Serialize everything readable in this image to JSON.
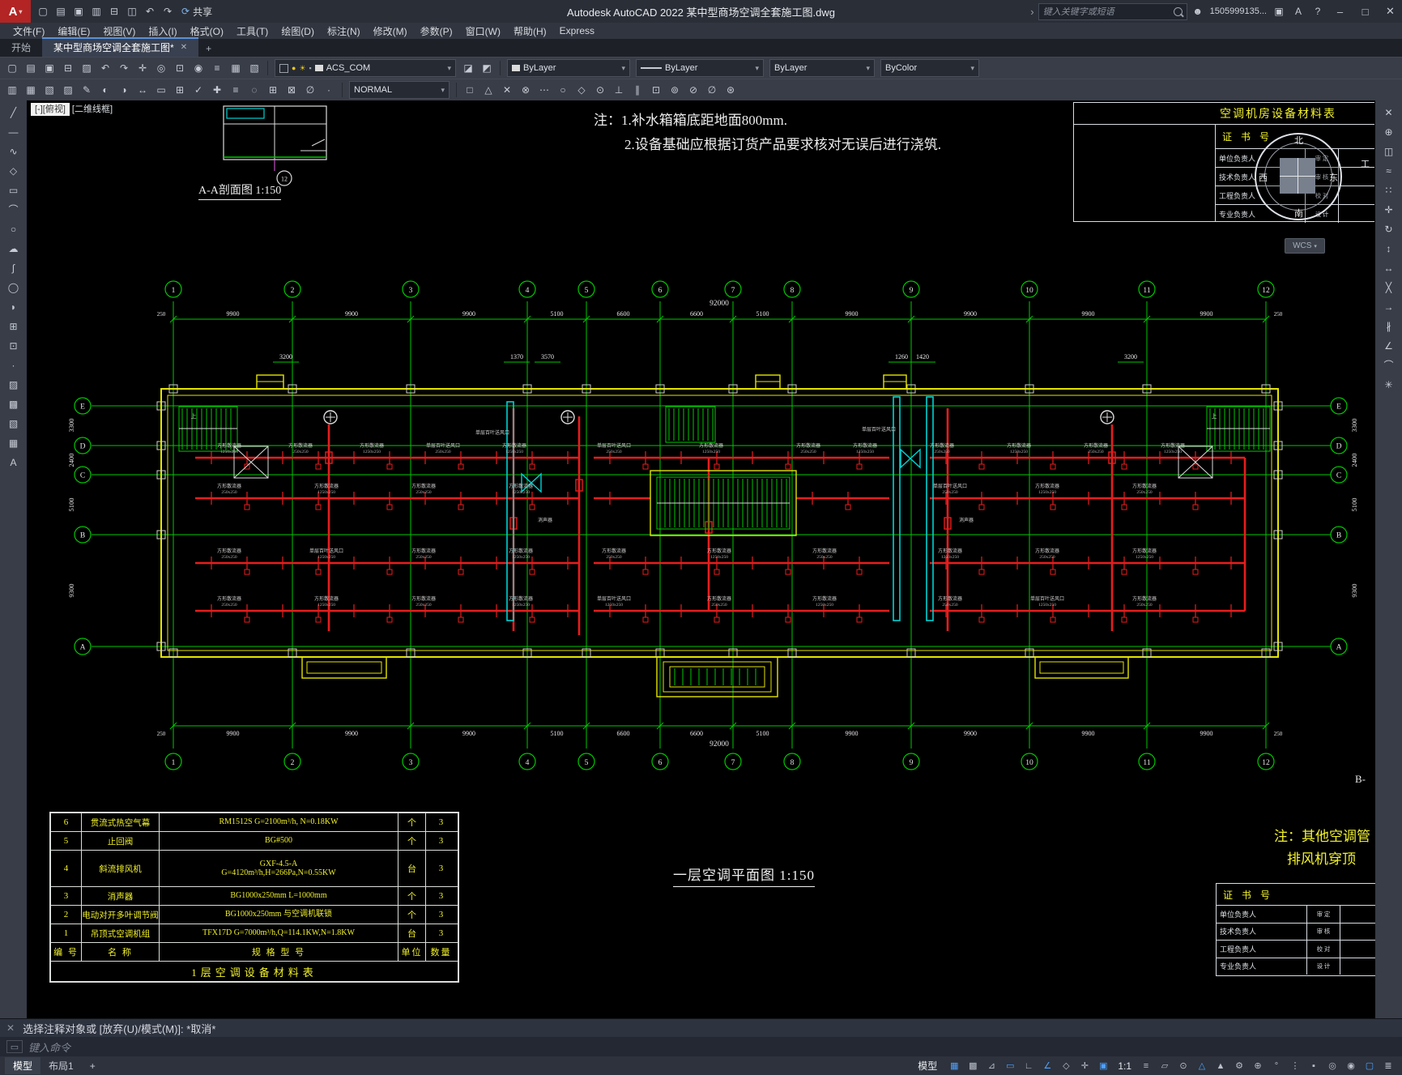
{
  "titlebar": {
    "app_button": "A",
    "share": "共享",
    "title": "Autodesk AutoCAD 2022   某中型商场空调全套施工图.dwg",
    "search_placeholder": "键入关键字或短语",
    "user": "1505999135...",
    "account": "A",
    "help": "?",
    "window_buttons": {
      "minimize": "–",
      "maximize": "□",
      "close": "✕"
    }
  },
  "menubar": {
    "items": [
      "文件(F)",
      "编辑(E)",
      "视图(V)",
      "插入(I)",
      "格式(O)",
      "工具(T)",
      "绘图(D)",
      "标注(N)",
      "修改(M)",
      "参数(P)",
      "窗口(W)",
      "帮助(H)",
      "Express"
    ]
  },
  "tabs": {
    "start": "开始",
    "drawing": "某中型商场空调全套施工图*",
    "close": "✕",
    "add": "+"
  },
  "toolbars": {
    "layer": "ACS_COM",
    "color": "ByLayer",
    "linetype": "ByLayer",
    "lineweight": "ByLayer",
    "plotstyle": "ByColor",
    "style": "NORMAL"
  },
  "icons": {
    "qat": [
      "new-file",
      "open-file",
      "save",
      "save-as",
      "plot",
      "print-preview",
      "undo",
      "redo"
    ],
    "tb1a": [
      "new-file",
      "open-file",
      "save",
      "plot",
      "match-properties",
      "undo",
      "redo",
      "pan",
      "zoom-realtime",
      "zoom-window",
      "zoom-previous",
      "layer-properties",
      "layer-states",
      "layer-walk"
    ],
    "tb1b": [
      "make-object-layer-current",
      "layer-previous"
    ],
    "tb2a": [
      "properties-palette",
      "design-center",
      "tool-palettes",
      "sheet-set",
      "markup",
      "render",
      "materials",
      "distance",
      "area",
      "calculator",
      "spell-check",
      "quick-select",
      "draw-order",
      "isolate",
      "group",
      "ungroup",
      "measure",
      "point-style"
    ],
    "tb2b": [
      "snap-endpoint",
      "snap-midpoint",
      "snap-intersection",
      "snap-apparent",
      "snap-extension",
      "snap-center",
      "snap-quadrant",
      "snap-tangent",
      "snap-perpendicular",
      "snap-parallel",
      "snap-insertion",
      "snap-node",
      "snap-nearest",
      "snap-none",
      "osnap-settings"
    ],
    "left_toolbar": [
      "line",
      "construction-line",
      "polyline",
      "polygon",
      "rectangle",
      "arc",
      "circle",
      "revision-cloud",
      "spline",
      "ellipse",
      "ellipse-arc",
      "insert-block",
      "make-block",
      "point",
      "hatch",
      "gradient",
      "region",
      "table",
      "mtext"
    ],
    "right_toolbar": [
      "erase",
      "copy",
      "mirror",
      "offset",
      "array",
      "move",
      "rotate",
      "scale",
      "stretch",
      "trim",
      "extend",
      "break",
      "chamfer",
      "fillet",
      "explode"
    ],
    "statusbar_a": [
      "grid",
      "snap-mode",
      "infer-constraints",
      "dynamic-input",
      "ortho",
      "polar-tracking",
      "isometric-drafting",
      "object-snap-tracking",
      "object-snap"
    ],
    "statusbar_b": [
      "lineweight",
      "transparency",
      "selection-cycling",
      "annotation-visibility",
      "autoscale",
      "workspace",
      "annotation-monitor",
      "units",
      "quick-properties",
      "lock-ui",
      "isolate-objects",
      "graphics-performance",
      "clean-screen",
      "customize"
    ]
  },
  "viewport": {
    "controls_left": "[-][俯视]",
    "controls_right": "[二维线框]",
    "wcs": "WCS"
  },
  "command": {
    "history": "选择注释对象或  [放弃(U)/模式(M)]:  *取消*",
    "placeholder": "键入命令"
  },
  "statusbar": {
    "model_tab": "模型",
    "layout_tab": "布局1",
    "add_tab": "+",
    "model_label": "模型",
    "scale": "1:1"
  },
  "drawing": {
    "notes": [
      "注：1.补水箱箱底距地面800mm.",
      "2.设备基础应根据订货产品要求核对无误后进行浇筑."
    ],
    "section_label": "A-A剖面图 1:150",
    "section_bubble": "12",
    "plan_label": "一层空调平面图 1:150",
    "side_note_1": "注：其他空调管",
    "side_note_2": "排风机穿顶",
    "b_label": "B-",
    "grid_cols": [
      "1",
      "2",
      "3",
      "4",
      "5",
      "6",
      "7",
      "8",
      "9",
      "10",
      "11",
      "12"
    ],
    "grid_rows": [
      "E",
      "D",
      "C",
      "B",
      "A"
    ],
    "dims_top": [
      "9900",
      "9900",
      "9900",
      "5100",
      "6600",
      "6600",
      "5100",
      "9900",
      "9900",
      "9900",
      "9900"
    ],
    "dims_total": "92000",
    "dims_edge": "250",
    "sub_dims": [
      "3200",
      "1370",
      "3570",
      "1260",
      "1420",
      "3200"
    ],
    "left_dims": [
      "3300",
      "2400",
      "5100",
      "9300"
    ],
    "labels": {
      "diffuser": "方形散流器",
      "grille": "单层百叶送风口",
      "silencer": "消声器",
      "up": "上",
      "size_small": "250x250",
      "size_large": "1250x250"
    }
  },
  "equipment_table": {
    "rows": [
      {
        "no": "6",
        "name": "贯流式热空气幕",
        "spec": "RM1512S    G=2100m³/h, N=0.18KW",
        "unit": "个",
        "qty": "3"
      },
      {
        "no": "5",
        "name": "止回阀",
        "spec": "BG#500",
        "unit": "个",
        "qty": "3"
      },
      {
        "no": "4",
        "name": "斜流排风机",
        "spec": "GXF-4.5-A",
        "spec2": "G=4120m³/h,H=266Pa,N=0.55KW",
        "unit": "台",
        "qty": "3"
      },
      {
        "no": "3",
        "name": "消声器",
        "spec": "BG1000x250mm    L=1000mm",
        "unit": "个",
        "qty": "3"
      },
      {
        "no": "2",
        "name": "电动对开多叶调节阀",
        "spec": "BG1000x250mm  与空调机联锁",
        "unit": "个",
        "qty": "3"
      },
      {
        "no": "1",
        "name": "吊顶式空调机组",
        "spec": "TFX17D   G=7000m³/h,Q=114.1KW,N=1.8KW",
        "unit": "台",
        "qty": "3"
      }
    ],
    "headers": [
      "编 号",
      "名   称",
      "规 格 型 号",
      "单位",
      "数量"
    ],
    "title": "1层空调设备材料表"
  },
  "title_blocks": {
    "material_header": "空调机房设备材料表",
    "cert": "证 书 号",
    "roles": [
      "单位负责人",
      "技术负责人",
      "工程负责人",
      "专业负责人"
    ],
    "cells": [
      "审 定",
      "审 核",
      "校 对",
      "设 计"
    ],
    "side_char": "工",
    "compass": {
      "n": "北",
      "s": "南",
      "e": "东",
      "w": "西"
    }
  }
}
